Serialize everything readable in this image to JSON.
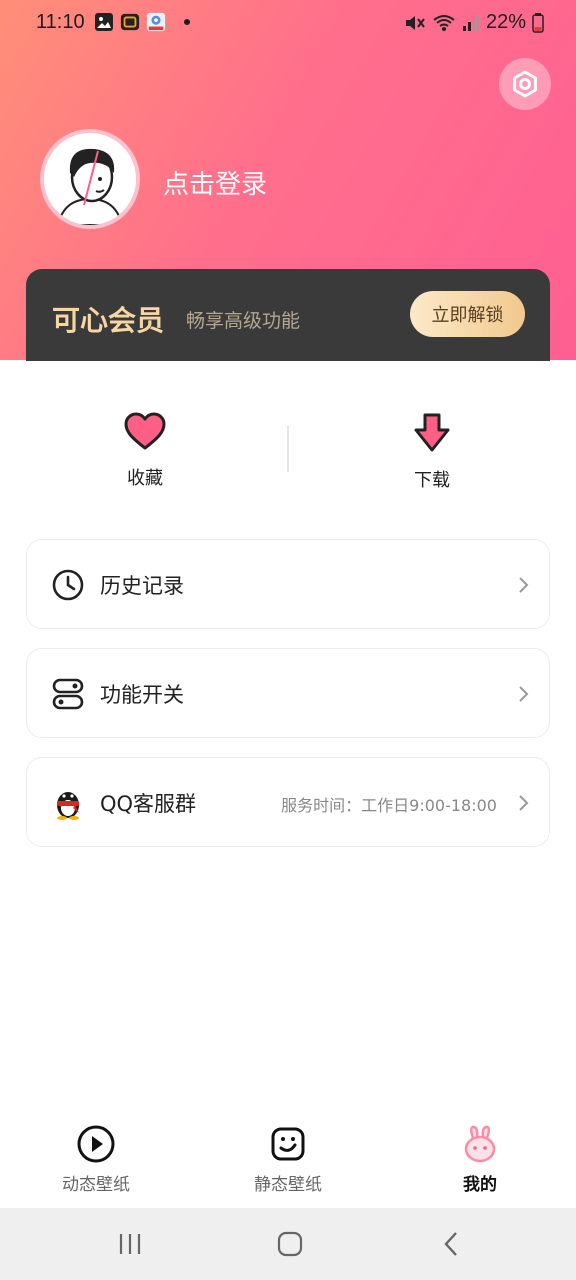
{
  "status_bar": {
    "time": "11:10",
    "battery": "22%"
  },
  "profile": {
    "login_prompt": "点击登录"
  },
  "vip": {
    "title": "可心会员",
    "subtitle": "畅享高级功能",
    "button": "立即解锁"
  },
  "quick_actions": [
    {
      "label": "收藏",
      "icon": "heart-icon"
    },
    {
      "label": "下载",
      "icon": "download-icon"
    }
  ],
  "menu": [
    {
      "label": "历史记录",
      "icon": "clock-icon",
      "extra": ""
    },
    {
      "label": "功能开关",
      "icon": "toggle-icon",
      "extra": ""
    },
    {
      "label": "QQ客服群",
      "icon": "qq-penguin-icon",
      "extra": "服务时间：工作日9:00-18:00"
    }
  ],
  "tabs": [
    {
      "label": "动态壁纸",
      "icon": "play-icon",
      "active": false
    },
    {
      "label": "静态壁纸",
      "icon": "smile-icon",
      "active": false
    },
    {
      "label": "我的",
      "icon": "bunny-icon",
      "active": true
    }
  ],
  "colors": {
    "header_gradient_start": "#ff8f78",
    "header_gradient_end": "#ff5f92",
    "accent_pink": "#ff5f84",
    "vip_gold": "#f6d7a3",
    "vip_card": "#3a3a3a"
  }
}
